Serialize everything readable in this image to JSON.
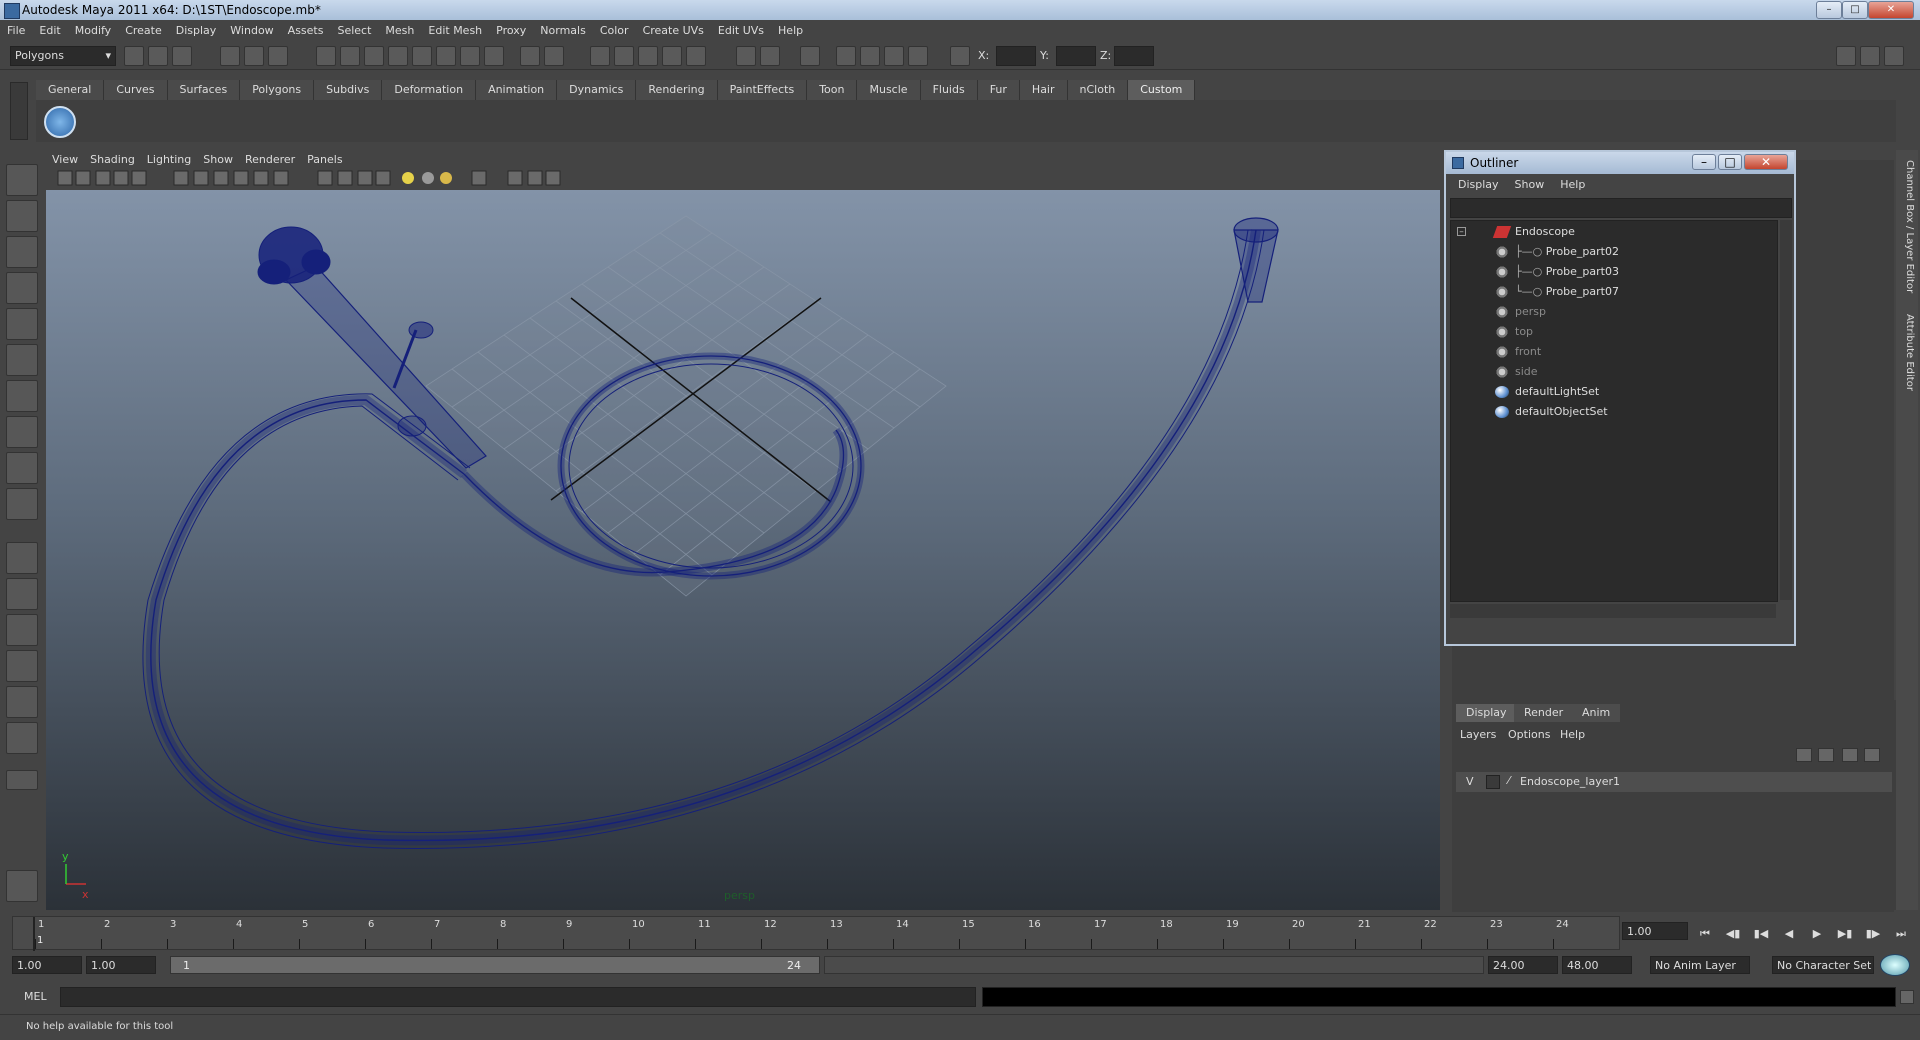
{
  "window": {
    "title": "Autodesk Maya 2011 x64: D:\\1ST\\Endoscope.mb*"
  },
  "menubar": [
    "File",
    "Edit",
    "Modify",
    "Create",
    "Display",
    "Window",
    "Assets",
    "Select",
    "Mesh",
    "Edit Mesh",
    "Proxy",
    "Normals",
    "Color",
    "Create UVs",
    "Edit UVs",
    "Help"
  ],
  "statusline": {
    "mode": "Polygons",
    "x_label": "X:",
    "y_label": "Y:",
    "z_label": "Z:"
  },
  "shelf": {
    "tabs": [
      "General",
      "Curves",
      "Surfaces",
      "Polygons",
      "Subdivs",
      "Deformation",
      "Animation",
      "Dynamics",
      "Rendering",
      "PaintEffects",
      "Toon",
      "Muscle",
      "Fluids",
      "Fur",
      "Hair",
      "nCloth",
      "Custom"
    ],
    "active": "Custom"
  },
  "viewport": {
    "menu": [
      "View",
      "Shading",
      "Lighting",
      "Show",
      "Renderer",
      "Panels"
    ],
    "camera_label": "persp",
    "axis_x": "x",
    "axis_y": "y"
  },
  "outliner": {
    "title": "Outliner",
    "menu": [
      "Display",
      "Show",
      "Help"
    ],
    "items": [
      {
        "label": "Endoscope",
        "muted": false
      },
      {
        "label": "Probe_part02",
        "muted": false
      },
      {
        "label": "Probe_part03",
        "muted": false
      },
      {
        "label": "Probe_part07",
        "muted": false
      },
      {
        "label": "persp",
        "muted": true
      },
      {
        "label": "top",
        "muted": true
      },
      {
        "label": "front",
        "muted": true
      },
      {
        "label": "side",
        "muted": true
      },
      {
        "label": "defaultLightSet",
        "muted": false
      },
      {
        "label": "defaultObjectSet",
        "muted": false
      }
    ]
  },
  "side_tabs": [
    "Channel Box / Layer Editor",
    "Attribute Editor"
  ],
  "layer_editor": {
    "tabs": [
      "Display",
      "Render",
      "Anim"
    ],
    "menu": [
      "Layers",
      "Options",
      "Help"
    ],
    "layer": {
      "visible": "V",
      "name": "Endoscope_layer1"
    }
  },
  "timeline": {
    "ticks": [
      "1",
      "2",
      "3",
      "4",
      "5",
      "6",
      "7",
      "8",
      "9",
      "10",
      "11",
      "12",
      "13",
      "14",
      "15",
      "16",
      "17",
      "18",
      "19",
      "20",
      "21",
      "22",
      "23",
      "24"
    ],
    "current_frame_marker": "1",
    "current_frame": "1.00"
  },
  "range": {
    "start": "1.00",
    "playback_start": "1.00",
    "range_min": "1",
    "range_max": "24",
    "playback_end": "24.00",
    "end": "48.00",
    "anim_layer": "No Anim Layer",
    "character_set": "No Character Set"
  },
  "command": {
    "label": "MEL"
  },
  "help_line": "No help available for this tool"
}
